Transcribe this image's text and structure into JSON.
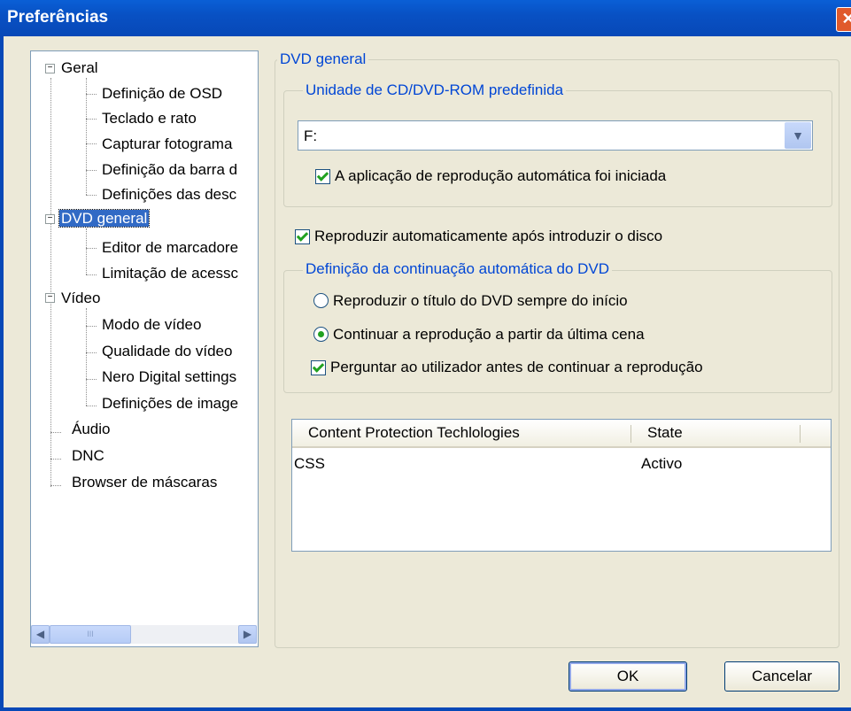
{
  "window": {
    "title": "Preferências"
  },
  "tree": {
    "items": [
      {
        "label": "Geral"
      },
      {
        "label": "Definição de OSD"
      },
      {
        "label": "Teclado e rato"
      },
      {
        "label": "Capturar fotograma"
      },
      {
        "label": "Definição da barra d"
      },
      {
        "label": "Definições das desc"
      },
      {
        "label": "DVD general"
      },
      {
        "label": "Editor de marcadore"
      },
      {
        "label": "Limitação de acessc"
      },
      {
        "label": "Vídeo"
      },
      {
        "label": "Modo de vídeo"
      },
      {
        "label": "Qualidade do vídeo"
      },
      {
        "label": "Nero Digital settings"
      },
      {
        "label": "Definições de image"
      },
      {
        "label": "Áudio"
      },
      {
        "label": "DNC"
      },
      {
        "label": "Browser de máscaras"
      }
    ],
    "expander_symbol": "−",
    "scroll_grip": "III"
  },
  "panel": {
    "title": "DVD general",
    "drive_group": {
      "title": "Unidade de CD/DVD-ROM predefinida",
      "drive_value": "F:",
      "autoplay_label": "A aplicação de reprodução automática foi iniciada"
    },
    "autoplay_insert_label": "Reproduzir automaticamente após introduzir o disco",
    "resume_group": {
      "title": "Definição da continuação automática do DVD",
      "option_start": "Reproduzir o título do DVD sempre do início",
      "option_resume": "Continuar a reprodução a partir da última cena",
      "ask_label": "Perguntar ao utilizador antes de continuar a reprodução"
    },
    "protection_list": {
      "columns": [
        "Content Protection Techlologies",
        "State"
      ],
      "rows": [
        {
          "tech": "CSS",
          "state": "Activo"
        }
      ]
    }
  },
  "buttons": {
    "ok": "OK",
    "cancel": "Cancelar"
  },
  "glyphs": {
    "close": "✕",
    "dropdown": "▼",
    "left": "◀",
    "right": "▶"
  }
}
